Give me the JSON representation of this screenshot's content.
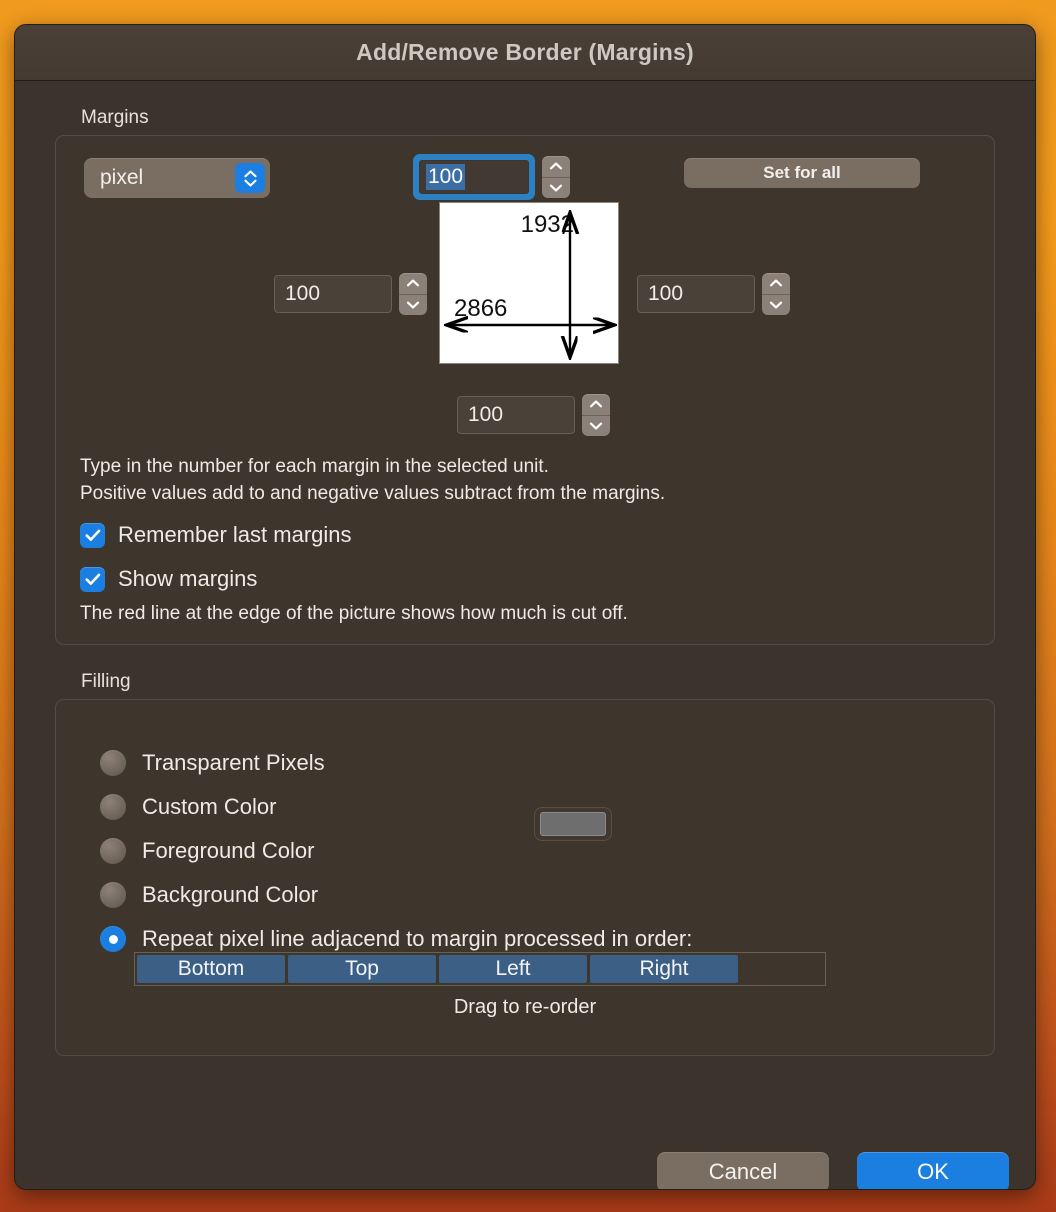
{
  "window": {
    "title": "Add/Remove Border (Margins)"
  },
  "margins": {
    "group_label": "Margins",
    "unit": {
      "value": "pixel",
      "icon": "chevron-up-down-icon"
    },
    "set_for_all_label": "Set for all",
    "top_value": "100",
    "left_value": "100",
    "right_value": "100",
    "bottom_value": "100",
    "preview": {
      "height_label": "1932",
      "width_label": "2866"
    },
    "help_line_1": "Type in the number for each margin in the selected unit.",
    "help_line_2": "Positive values add to and negative values subtract from the margins.",
    "checkboxes": [
      {
        "label": "Remember last margins",
        "checked": true
      },
      {
        "label": "Show margins",
        "checked": true
      }
    ],
    "help_line_3": "The red line at the edge of the picture shows how much is cut off."
  },
  "filling": {
    "group_label": "Filling",
    "options": [
      {
        "label": "Transparent Pixels",
        "selected": false
      },
      {
        "label": "Custom Color",
        "selected": false
      },
      {
        "label": "Foreground Color",
        "selected": false
      },
      {
        "label": "Background Color",
        "selected": false
      },
      {
        "label": "Repeat pixel line adjacend to margin processed in order:",
        "selected": true
      }
    ],
    "custom_color_swatch": "#6e6e6e",
    "order_chips": [
      "Bottom",
      "Top",
      "Left",
      "Right"
    ],
    "drag_note": "Drag to re-order"
  },
  "footer": {
    "cancel_label": "Cancel",
    "ok_label": "OK"
  },
  "colors": {
    "accent": "#1a7fe0",
    "dialog_bg": "#3c342c",
    "chip": "#3c5f86",
    "focus_ring": "#2c81c4"
  }
}
